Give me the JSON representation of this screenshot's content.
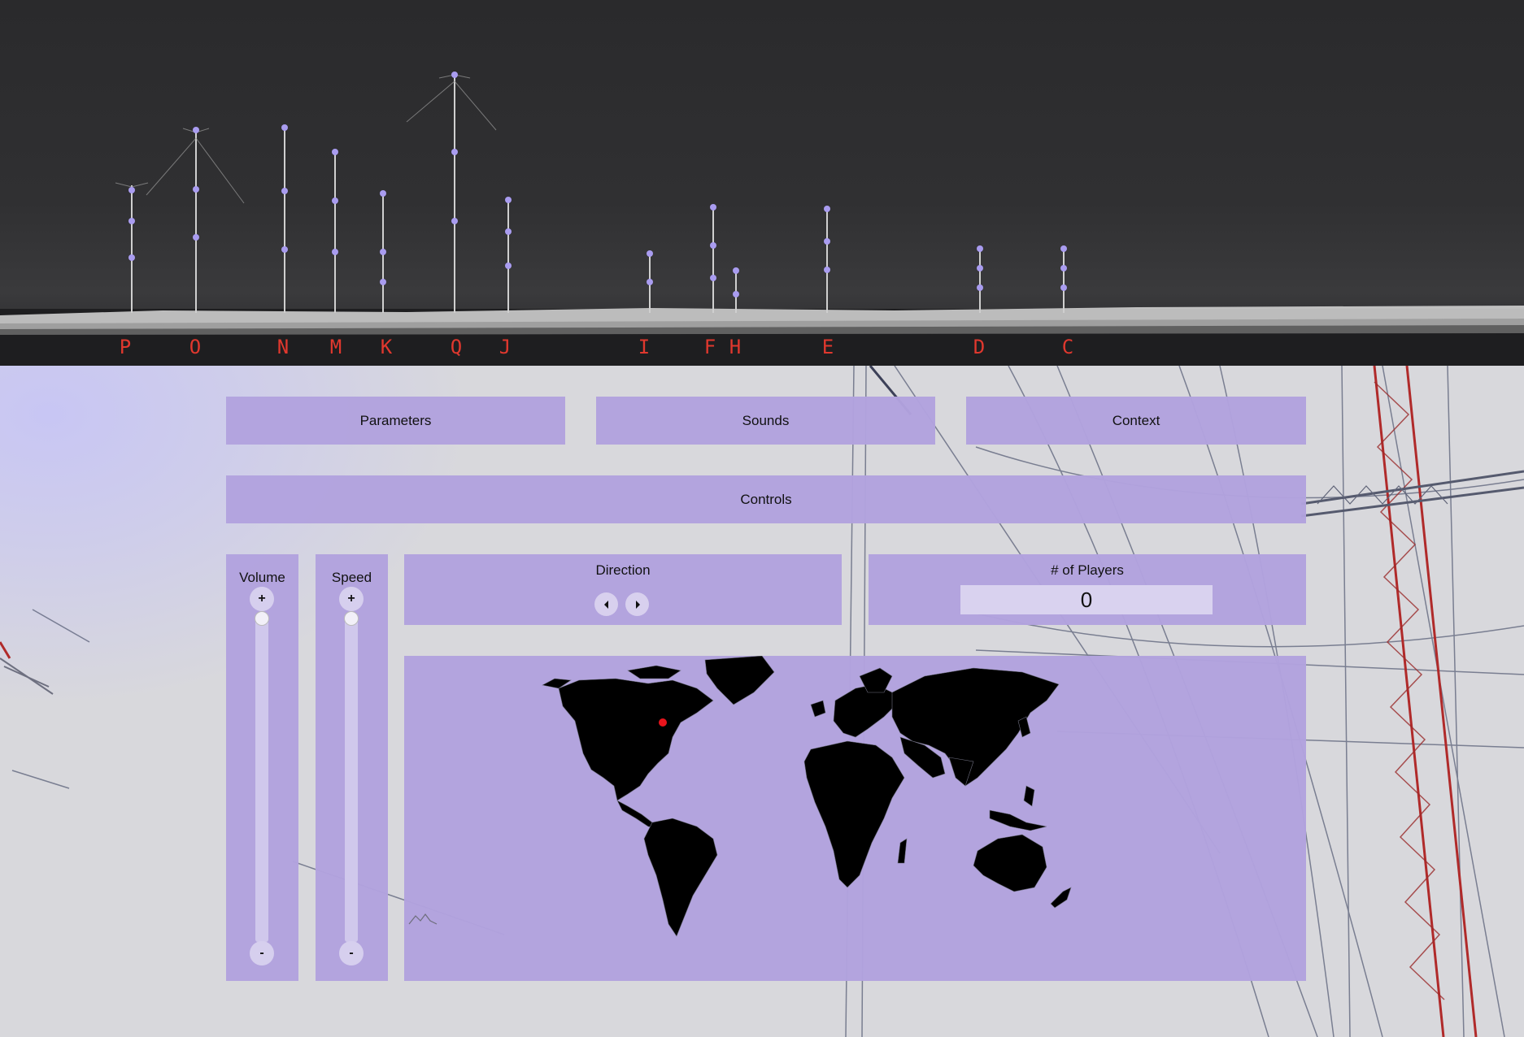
{
  "banner": {
    "mast_labels": [
      "P",
      "O",
      "N",
      "M",
      "K",
      "Q",
      "J",
      "I",
      "F",
      "H",
      "E",
      "D",
      "C"
    ]
  },
  "nav": {
    "parameters_label": "Parameters",
    "sounds_label": "Sounds",
    "context_label": "Context",
    "controls_label": "Controls"
  },
  "volume": {
    "title": "Volume",
    "plus": "+",
    "minus": "-",
    "level": 1.0
  },
  "speed": {
    "title": "Speed",
    "plus": "+",
    "minus": "-",
    "level": 1.0
  },
  "direction": {
    "title": "Direction"
  },
  "players": {
    "title": "# of Players",
    "count": "0"
  },
  "map": {
    "marker_color": "#e8141c",
    "land_color": "#000000",
    "background": "#b3a3de"
  },
  "colors": {
    "panel": "#b2a2de",
    "label_red": "#e0382e",
    "mast_dot": "#a99cf0"
  }
}
